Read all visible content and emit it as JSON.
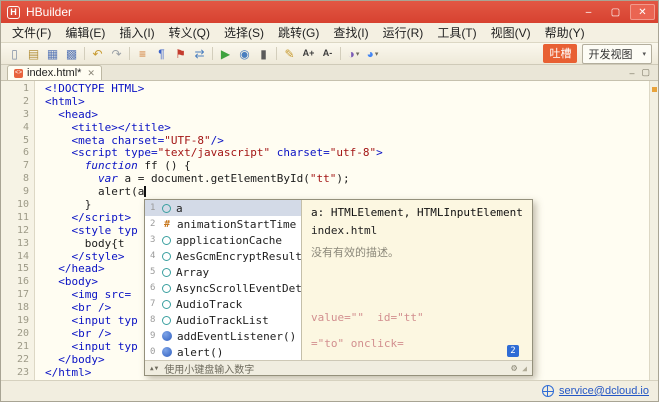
{
  "titlebar": {
    "logo": "H",
    "title": "HBuilder",
    "minimize": "–",
    "maximize": "▢",
    "close": "✕"
  },
  "menubar": {
    "items": [
      "文件(F)",
      "编辑(E)",
      "插入(I)",
      "转义(Q)",
      "选择(S)",
      "跳转(G)",
      "查找(I)",
      "运行(R)",
      "工具(T)",
      "视图(V)",
      "帮助(Y)"
    ]
  },
  "toolbar": {
    "buttons": [
      {
        "name": "new-file",
        "glyph": "▯",
        "color": "#7d8ca3"
      },
      {
        "name": "new-project",
        "glyph": "▤",
        "color": "#b3903c"
      },
      {
        "name": "save",
        "glyph": "▦",
        "color": "#5a79b8"
      },
      {
        "name": "save-all",
        "glyph": "▩",
        "color": "#5a79b8"
      },
      {
        "sep": true
      },
      {
        "name": "undo",
        "glyph": "↶",
        "color": "#c79a2f"
      },
      {
        "name": "redo",
        "glyph": "↷",
        "color": "#9aa0a6"
      },
      {
        "sep": true
      },
      {
        "name": "format-code",
        "glyph": "≡",
        "color": "#d0782f"
      },
      {
        "name": "show-paragraph",
        "glyph": "¶",
        "color": "#3b62c9"
      },
      {
        "name": "bookmark",
        "glyph": "⚑",
        "color": "#c43c2e"
      },
      {
        "name": "match-pair",
        "glyph": "⇄",
        "color": "#4a7fbf"
      },
      {
        "sep": true
      },
      {
        "name": "run",
        "glyph": "▶",
        "color": "#3fa23f"
      },
      {
        "name": "debug",
        "glyph": "◉",
        "color": "#4a7fbf"
      },
      {
        "name": "device-run",
        "glyph": "▮",
        "color": "#5a5a5a"
      },
      {
        "sep": true
      },
      {
        "name": "edit-pencil",
        "glyph": "✎",
        "color": "#c79a2f"
      },
      {
        "name": "font-increase",
        "glyph": "A+",
        "color": "#3b3b3b"
      },
      {
        "name": "font-decrease",
        "glyph": "A-",
        "color": "#3b3b3b"
      },
      {
        "sep": true
      },
      {
        "name": "theme",
        "glyph": "◑",
        "color": "#7a5ab5",
        "caret": true
      },
      {
        "name": "browser-run",
        "glyph": "◕",
        "color": "#4285f4",
        "caret": true
      }
    ],
    "caret_glyph": "▾",
    "feedback_label": "吐槽",
    "view_mode": "开发视图"
  },
  "tabbar": {
    "tabs": [
      {
        "label": "index.html*"
      }
    ],
    "tab_icon_glyph": "<>",
    "close_glyph": "✕",
    "minimize_glyph": "–",
    "restore_glyph": "▢"
  },
  "editor": {
    "lines": [
      {
        "n": 1,
        "t": [
          [
            "tag",
            "<!DOCTYPE HTML>"
          ]
        ]
      },
      {
        "n": 2,
        "t": [
          [
            "tag",
            "<html>"
          ]
        ]
      },
      {
        "n": 3,
        "t": [
          [
            "pln",
            "  "
          ],
          [
            "tag",
            "<head>"
          ]
        ]
      },
      {
        "n": 4,
        "t": [
          [
            "pln",
            "    "
          ],
          [
            "tag",
            "<title></title>"
          ]
        ]
      },
      {
        "n": 5,
        "t": [
          [
            "pln",
            "    "
          ],
          [
            "tag",
            "<meta charset="
          ],
          [
            "str",
            "\"UTF-8\""
          ],
          [
            "tag",
            "/>"
          ]
        ]
      },
      {
        "n": 6,
        "t": [
          [
            "pln",
            "    "
          ],
          [
            "tag",
            "<script type="
          ],
          [
            "str",
            "\"text/javascript\""
          ],
          [
            "tag",
            " charset="
          ],
          [
            "str",
            "\"utf-8\""
          ],
          [
            "tag",
            ">"
          ]
        ]
      },
      {
        "n": 7,
        "t": [
          [
            "pln",
            "      "
          ],
          [
            "kw",
            "function"
          ],
          [
            "pln",
            " ff () {"
          ]
        ]
      },
      {
        "n": 8,
        "t": [
          [
            "pln",
            "        "
          ],
          [
            "kw",
            "var"
          ],
          [
            "pln",
            " a = document.getElementById("
          ],
          [
            "str",
            "\"tt\""
          ],
          [
            "pln",
            ");"
          ]
        ]
      },
      {
        "n": 9,
        "t": [
          [
            "pln",
            "        alert(a"
          ],
          [
            "caret",
            ""
          ]
        ]
      },
      {
        "n": 10,
        "t": [
          [
            "pln",
            "      }"
          ]
        ]
      },
      {
        "n": 11,
        "t": [
          [
            "pln",
            "    "
          ],
          [
            "tag",
            "</script>"
          ]
        ]
      },
      {
        "n": 12,
        "t": [
          [
            "pln",
            "    "
          ],
          [
            "tag",
            "<style typ"
          ]
        ]
      },
      {
        "n": 13,
        "t": [
          [
            "pln",
            "      body{t"
          ]
        ]
      },
      {
        "n": 14,
        "t": [
          [
            "pln",
            "    "
          ],
          [
            "tag",
            "</style>"
          ]
        ]
      },
      {
        "n": 15,
        "t": [
          [
            "pln",
            "  "
          ],
          [
            "tag",
            "</head>"
          ]
        ]
      },
      {
        "n": 16,
        "t": [
          [
            "pln",
            "  "
          ],
          [
            "tag",
            "<body>"
          ]
        ]
      },
      {
        "n": 17,
        "t": [
          [
            "pln",
            "    "
          ],
          [
            "tag",
            "<img src="
          ]
        ]
      },
      {
        "n": 18,
        "t": [
          [
            "pln",
            "    "
          ],
          [
            "tag",
            "<br />"
          ]
        ]
      },
      {
        "n": 19,
        "t": [
          [
            "pln",
            "    "
          ],
          [
            "tag",
            "<input typ"
          ]
        ]
      },
      {
        "n": 20,
        "t": [
          [
            "pln",
            "    "
          ],
          [
            "tag",
            "<br />"
          ]
        ]
      },
      {
        "n": 21,
        "t": [
          [
            "pln",
            "    "
          ],
          [
            "tag",
            "<input typ"
          ]
        ]
      },
      {
        "n": 22,
        "t": [
          [
            "pln",
            "  "
          ],
          [
            "tag",
            "</body>"
          ]
        ]
      },
      {
        "n": 23,
        "t": [
          [
            "tag",
            "</html>"
          ]
        ]
      }
    ]
  },
  "popup": {
    "items": [
      {
        "key": "1",
        "kind": "var",
        "label": "a",
        "selected": true
      },
      {
        "key": "2",
        "kind": "prop",
        "label": "animationStartTime"
      },
      {
        "key": "3",
        "kind": "var",
        "label": "applicationCache"
      },
      {
        "key": "4",
        "kind": "var",
        "label": "AesGcmEncryptResult"
      },
      {
        "key": "5",
        "kind": "var",
        "label": "Array"
      },
      {
        "key": "6",
        "kind": "var",
        "label": "AsyncScrollEventDetail"
      },
      {
        "key": "7",
        "kind": "var",
        "label": "AudioTrack"
      },
      {
        "key": "8",
        "kind": "var",
        "label": "AudioTrackList"
      },
      {
        "key": "9",
        "kind": "fn",
        "label": "addEventListener()"
      },
      {
        "key": "0",
        "kind": "fn",
        "label": "alert()"
      }
    ],
    "doc": {
      "title": "a: HTMLElement, HTMLInputElement",
      "file": "index.html",
      "desc": "没有有效的描述。",
      "snippets": [
        "value=\"\"  id=\"tt\"",
        "=\"to\" onclick="
      ],
      "badge": "2"
    },
    "hint": {
      "arrows": "▲▼",
      "text": "使用小键盘输入数字",
      "gear": "⚙",
      "grip": "◢"
    }
  },
  "statusbar": {
    "link": "service@dcloud.io"
  },
  "colors": {
    "accent_red": "#d74230",
    "feedback_orange": "#e86033",
    "link_blue": "#2457c5",
    "selection": "#d3dae7"
  }
}
